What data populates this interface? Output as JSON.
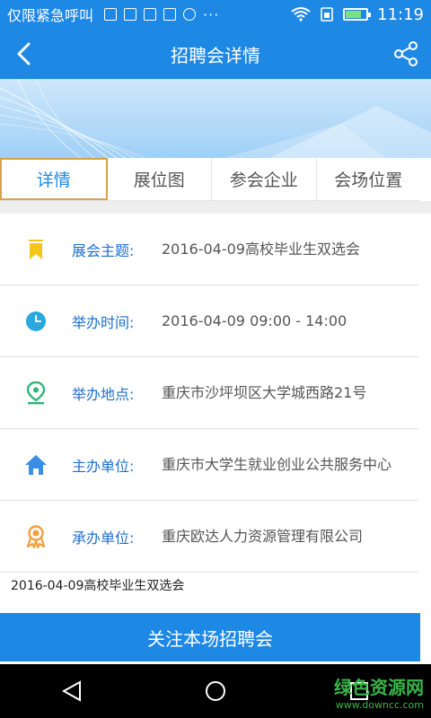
{
  "status_bar": {
    "notification": "仅限紧急呼叫",
    "more": "···",
    "time": "11:19",
    "battery_level": 0.75
  },
  "header": {
    "title": "招聘会详情"
  },
  "tabs": [
    {
      "label": "详情"
    },
    {
      "label": "展位图"
    },
    {
      "label": "参会企业"
    },
    {
      "label": "会场位置"
    }
  ],
  "info": {
    "theme_label": "展会主题:",
    "theme_value": "2016-04-09高校毕业生双选会",
    "time_label": "举办时间:",
    "time_value": "2016-04-09 09:00 - 14:00",
    "location_label": "举办地点:",
    "location_value": "重庆市沙坪坝区大学城西路21号",
    "host_label": "主办单位:",
    "host_value": "重庆市大学生就业创业公共服务中心",
    "organizer_label": "承办单位:",
    "organizer_value": "重庆欧达人力资源管理有限公司"
  },
  "bottom_text": "2016-04-09高校毕业生双选会",
  "follow_button": "关注本场招聘会",
  "watermark": {
    "title": "绿色资源网",
    "url": "www.downcc.com"
  },
  "colors": {
    "primary": "#1e88e5",
    "label": "#1e6fd1",
    "tab_active_border": "#d9a24a",
    "icon_theme": "#f5c518",
    "icon_time": "#29a9e1",
    "icon_location": "#2fb67a",
    "icon_host": "#3b8de6",
    "icon_organizer": "#f0a040"
  }
}
